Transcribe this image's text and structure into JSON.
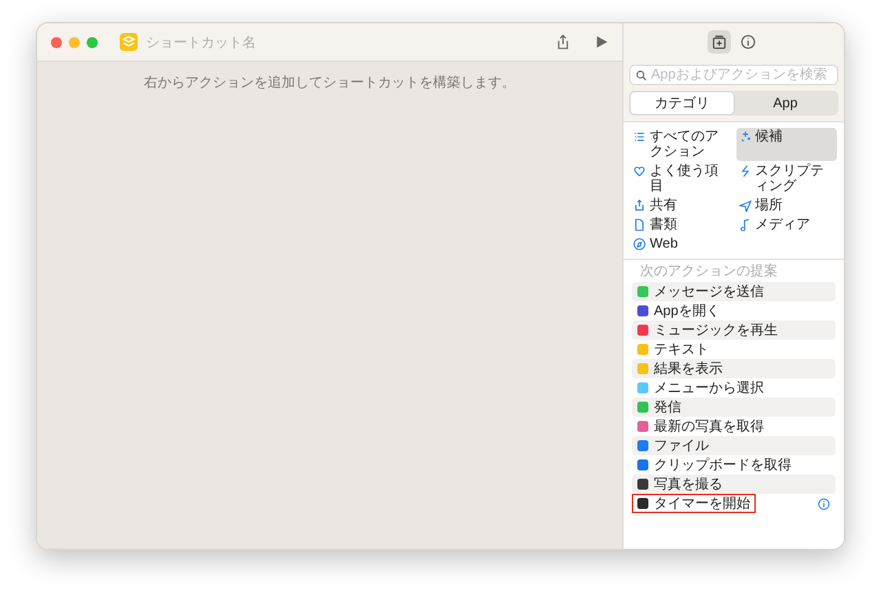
{
  "window": {
    "title": "ショートカット名"
  },
  "editor": {
    "hint": "右からアクションを追加してショートカットを構築します。"
  },
  "sidebar": {
    "tabs": [
      {
        "kind": "library",
        "selected": true
      },
      {
        "kind": "info",
        "selected": false
      }
    ],
    "search": {
      "placeholder": "Appおよびアクションを検索"
    },
    "segments": [
      {
        "label": "カテゴリ",
        "selected": true
      },
      {
        "label": "App",
        "selected": false
      }
    ],
    "categories": [
      {
        "label": "すべてのアクション",
        "kind": "list",
        "selected": false
      },
      {
        "label": "候補",
        "kind": "sparkle",
        "selected": true
      },
      {
        "label": "よく使う項目",
        "kind": "heart",
        "selected": false
      },
      {
        "label": "スクリプティング",
        "kind": "script",
        "selected": false
      },
      {
        "label": "共有",
        "kind": "share",
        "selected": false
      },
      {
        "label": "場所",
        "kind": "location",
        "selected": false
      },
      {
        "label": "書類",
        "kind": "doc",
        "selected": false
      },
      {
        "label": "メディア",
        "kind": "music",
        "selected": false
      },
      {
        "label": "Web",
        "kind": "compass",
        "selected": false
      }
    ],
    "suggestions_title": "次のアクションの提案",
    "suggestions": [
      {
        "label": "メッセージを送信",
        "color": "#34c759",
        "selected": false
      },
      {
        "label": "Appを開く",
        "color": "#4b4fd6",
        "selected": false
      },
      {
        "label": "ミュージックを再生",
        "color": "#f23a4f",
        "selected": false
      },
      {
        "label": "テキスト",
        "color": "#fbbf1a",
        "selected": false
      },
      {
        "label": "結果を表示",
        "color": "#f7c21c",
        "selected": false
      },
      {
        "label": "メニューから選択",
        "color": "#5ac8fa",
        "selected": false
      },
      {
        "label": "発信",
        "color": "#30c254",
        "selected": false
      },
      {
        "label": "最新の写真を取得",
        "color": "#e85d9c",
        "selected": false
      },
      {
        "label": "ファイル",
        "color": "#1e7cf2",
        "selected": false
      },
      {
        "label": "クリップボードを取得",
        "color": "#1a73e8",
        "selected": false
      },
      {
        "label": "写真を撮る",
        "color": "#3a3a3c",
        "selected": false
      },
      {
        "label": "タイマーを開始",
        "color": "#2b2b2b",
        "selected": true
      }
    ]
  }
}
